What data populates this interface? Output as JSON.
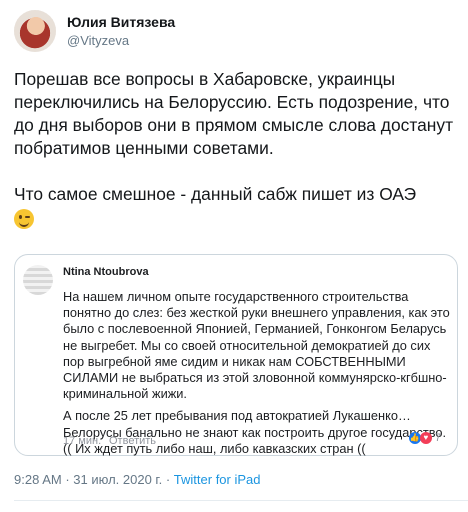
{
  "author": {
    "name": "Юлия Витязева",
    "handle": "@Vityzeva"
  },
  "tweet": {
    "text_1": "Порешав все вопросы в Хабаровске, украинцы переключились на Белоруссию. Есть подозрение, что до дня выборов они в прямом смысле слова достанут побратимов ценными советами.",
    "text_2": "Что самое смешное - данный сабж пишет из ОАЭ",
    "emoji": "winking-face"
  },
  "embedded_post": {
    "author_name": "Ntina Ntoubrova",
    "paragraph_1": "На нашем личном опыте государственного строительства понятно до слез: без жесткой руки внешнего управления, как это было с послевоенной Японией, Германией, Гонконгом Беларусь не выгребет. Мы со своей относительной демократией до сих пор выгребной яме сидим и никак нам СОБСТВЕННЫМИ СИЛАМИ не выбраться из этой зловонной коммунярско-кгбшно-криминальной жижи.",
    "paragraph_2": "А после 25 лет пребывания под автократией Лукашенко… Белорусы банально не знают как построить другое государство. (( Их ждет путь либо наш, либо кавказских стран ((",
    "time": "17 мин.",
    "reply_label": "Ответить",
    "reaction_count": "7",
    "like_color": "#1877f2",
    "love_color": "#f33e58"
  },
  "meta": {
    "time": "9:28 AM",
    "separator": "·",
    "date": "31 июл. 2020 г.",
    "source": "Twitter for iPad",
    "source_color": "#1b95e0"
  }
}
